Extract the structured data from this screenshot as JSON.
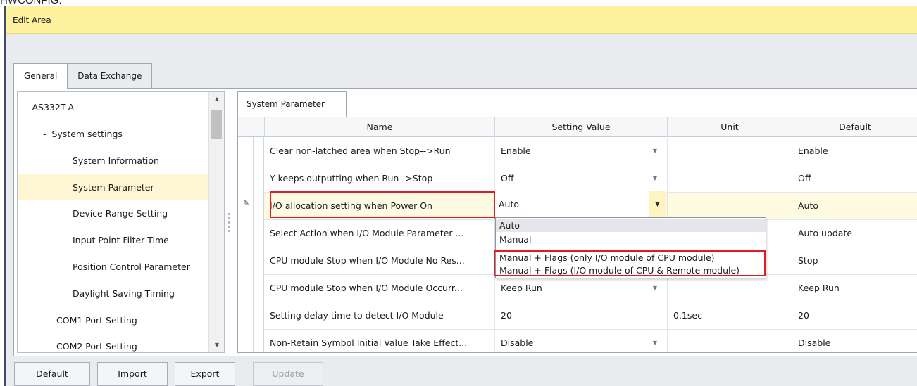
{
  "window": {
    "caption": "HWCONFIG:",
    "edit_area_title": "Edit Area"
  },
  "main_tabs": [
    {
      "label": "General",
      "active": true
    },
    {
      "label": "Data Exchange",
      "active": false
    }
  ],
  "tree": {
    "items": [
      {
        "label": "AS332T-A",
        "prefix": "-",
        "level": 0
      },
      {
        "label": "System settings",
        "prefix": "-",
        "level": 1
      },
      {
        "label": "System Information",
        "level": 2
      },
      {
        "label": "System Parameter",
        "level": 2,
        "selected": true
      },
      {
        "label": "Device Range Setting",
        "level": 2
      },
      {
        "label": "Input Point Filter Time",
        "level": 2
      },
      {
        "label": "Position Control Parameter",
        "level": 2
      },
      {
        "label": "Daylight Saving Timing",
        "level": 2
      },
      {
        "label": "COM1 Port Setting",
        "level": 1
      },
      {
        "label": "COM2 Port Setting",
        "level": 1
      }
    ]
  },
  "panel_tab": "System Parameter",
  "grid": {
    "headers": {
      "name": "Name",
      "setting_value": "Setting Value",
      "unit": "Unit",
      "default": "Default"
    },
    "rows": [
      {
        "name": "Clear non-latched area when Stop-->Run",
        "value": "Enable",
        "unit": "",
        "default": "Enable",
        "dropdown": true
      },
      {
        "name": "Y keeps outputting when Run-->Stop",
        "value": "Off",
        "unit": "",
        "default": "Off",
        "dropdown": true
      },
      {
        "name": "I/O allocation setting when Power On",
        "value": "Auto",
        "unit": "",
        "default": "Auto",
        "dropdown": true,
        "editing": true
      },
      {
        "name": "Select Action when I/O Module Parameter ...",
        "value": "",
        "unit": "",
        "default": "Auto update",
        "dropdown": false
      },
      {
        "name": "CPU module Stop when I/O Module No Res...",
        "value": "",
        "unit": "",
        "default": "Stop",
        "dropdown": false
      },
      {
        "name": "CPU module Stop when I/O Module Occurr...",
        "value": "Keep Run",
        "unit": "",
        "default": "Keep Run",
        "dropdown": true
      },
      {
        "name": "Setting delay time to detect I/O Module",
        "value": "20",
        "unit": "0.1sec",
        "default": "20",
        "dropdown": false
      },
      {
        "name": "Non-Retain Symbol Initial Value Take Effect...",
        "value": "Disable",
        "unit": "",
        "default": "Disable",
        "dropdown": true
      }
    ]
  },
  "dropdown_options": [
    "Auto",
    "Manual",
    "Manual + Flags (only I/O module of CPU module)",
    "Manual + Flags (I/O module of CPU & Remote module)"
  ],
  "buttons": {
    "default": "Default",
    "import": "Import",
    "export": "Export",
    "update": "Update"
  },
  "colors": {
    "edit_area_bg": "#fff29e",
    "highlight": "#e01b24",
    "selected_row": "#fff6d4"
  }
}
